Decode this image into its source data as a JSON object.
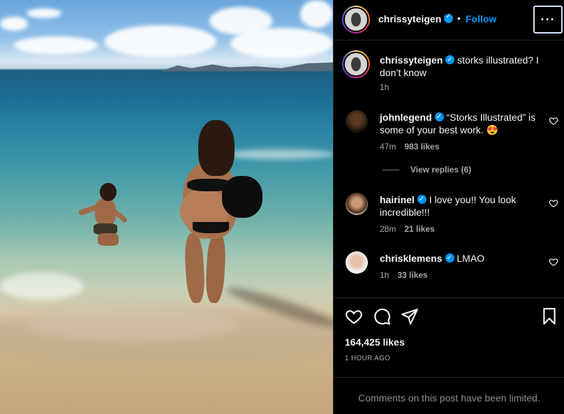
{
  "post": {
    "image_description_icon": "beach-photo",
    "author": "chrissyteigen",
    "follow_label": "Follow",
    "separator": "•",
    "more_label": "···",
    "caption": {
      "username": "chrissyteigen",
      "text": "storks illustrated? I don’t know",
      "time": "1h"
    }
  },
  "comments": [
    {
      "username": "johnlegend",
      "verified": true,
      "text": "“Storks Illustrated” is some of your best work. 😍",
      "time": "47m",
      "likes": "983 likes",
      "view_replies": "View replies (6)"
    },
    {
      "username": "hairinel",
      "verified": true,
      "text": "I love you!! You look incredible!!!",
      "time": "28m",
      "likes": "21 likes"
    },
    {
      "username": "chrisklemens",
      "verified": true,
      "text": "LMAO",
      "time": "1h",
      "likes": "33 likes"
    }
  ],
  "actions": {
    "like_icon": "heart-icon",
    "comment_icon": "comment-icon",
    "share_icon": "send-icon",
    "save_icon": "bookmark-icon"
  },
  "likes_count": "164,425 likes",
  "timestamp": "1 HOUR AGO",
  "comments_limited": "Comments on this post have been limited.",
  "colors": {
    "accent": "#0095f6",
    "background": "#000000",
    "muted": "#a8a8a8"
  }
}
